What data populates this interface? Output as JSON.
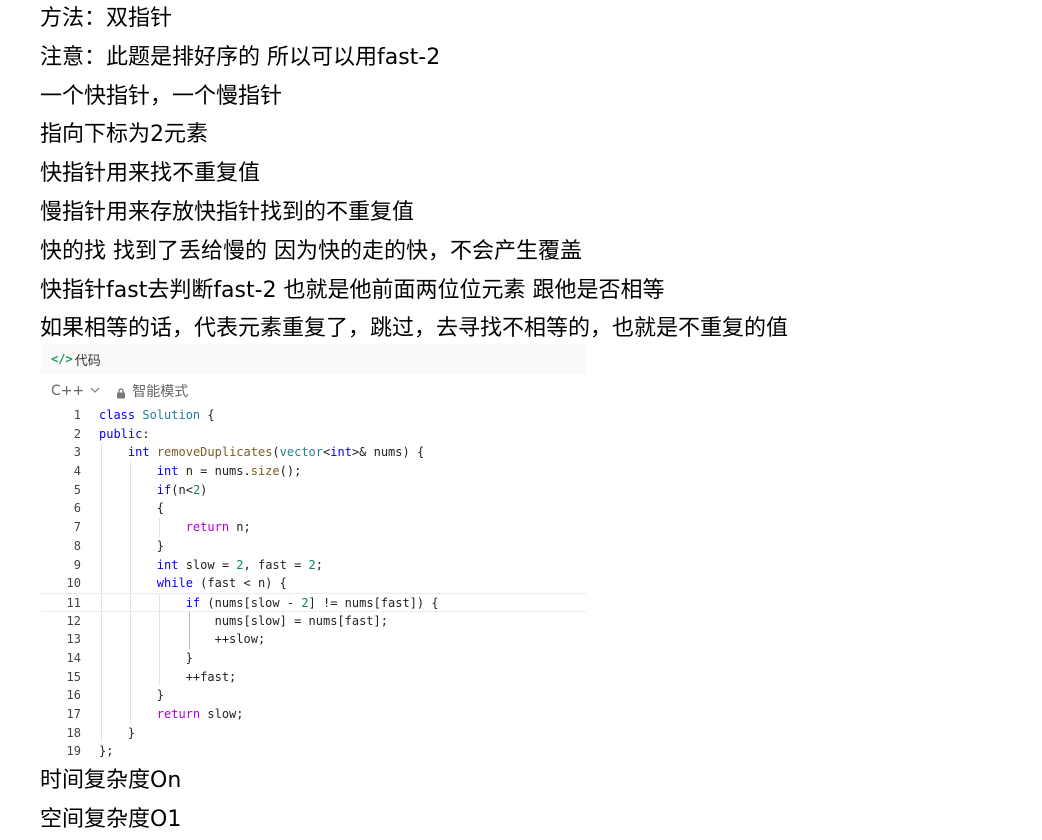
{
  "notes_top": [
    "方法：双指针",
    "注意：此题是排好序的 所以可以用fast-2",
    "一个快指针，一个慢指针",
    "指向下标为2元素",
    "快指针用来找不重复值",
    "慢指针用来存放快指针找到的不重复值",
    "快的找 找到了丢给慢的 因为快的走的快，不会产生覆盖",
    "快指针fast去判断fast-2 也就是他前面两位位元素 跟他是否相等",
    "如果相等的话，代表元素重复了，跳过，去寻找不相等的，也就是不重复的值"
  ],
  "code_block": {
    "header_icon": "</>",
    "header_title": "代码",
    "language": "C++",
    "mode_label": "智能模式",
    "active_line": 11,
    "lines": [
      "class Solution {",
      "public:",
      "    int removeDuplicates(vector<int>& nums) {",
      "        int n = nums.size();",
      "        if(n<2)",
      "        {",
      "            return n;",
      "        }",
      "        int slow = 2, fast = 2;",
      "        while (fast < n) {",
      "            if (nums[slow - 2] != nums[fast]) {",
      "                nums[slow] = nums[fast];",
      "                ++slow;",
      "            }",
      "            ++fast;",
      "        }",
      "        return slow;",
      "    }",
      "};"
    ],
    "line_numbers": [
      "1",
      "2",
      "3",
      "4",
      "5",
      "6",
      "7",
      "8",
      "9",
      "10",
      "11",
      "12",
      "13",
      "14",
      "15",
      "16",
      "17",
      "18",
      "19"
    ]
  },
  "notes_bottom": [
    "时间复杂度On",
    "空间复杂度O1"
  ]
}
